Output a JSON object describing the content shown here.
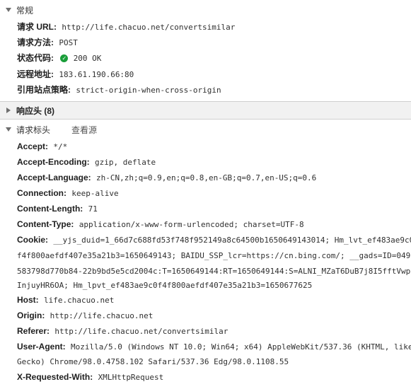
{
  "general": {
    "title": "常规",
    "request_url_label": "请求 URL:",
    "request_url": "http://life.chacuo.net/convertsimilar",
    "method_label": "请求方法:",
    "method": "POST",
    "status_label": "状态代码:",
    "status": "200 OK",
    "remote_label": "远程地址:",
    "remote": "183.61.190.66:80",
    "referrer_policy_label": "引用站点策略:",
    "referrer_policy": "strict-origin-when-cross-origin"
  },
  "response_headers": {
    "title": "响应头 (8)"
  },
  "request_headers": {
    "title": "请求标头",
    "view_source": "查看源",
    "accept": {
      "key": "Accept:",
      "value": "*/*"
    },
    "accept_encoding": {
      "key": "Accept-Encoding:",
      "value": "gzip, deflate"
    },
    "accept_language": {
      "key": "Accept-Language:",
      "value": "zh-CN,zh;q=0.9,en;q=0.8,en-GB;q=0.7,en-US;q=0.6"
    },
    "connection": {
      "key": "Connection:",
      "value": "keep-alive"
    },
    "content_length": {
      "key": "Content-Length:",
      "value": "71"
    },
    "content_type": {
      "key": "Content-Type:",
      "value": "application/x-www-form-urlencoded; charset=UTF-8"
    },
    "cookie": {
      "key": "Cookie:",
      "line1": "__yjs_duid=1_66d7c688fd53f748f952149a8c64500b1650649143014; Hm_lvt_ef483ae9c0",
      "line2": "f4f800aefdf407e35a21b3=1650649143; BAIDU_SSP_lcr=https://cn.bing.com/; __gads=ID=049",
      "line3": "583798d770b84-22b9bd5e5cd2004c:T=1650649144:RT=1650649144:S=ALNI_MZaT6DuB7j8I5fftVwp",
      "line4": "InjuyHR6OA; Hm_lpvt_ef483ae9c0f4f800aefdf407e35a21b3=1650677625"
    },
    "host": {
      "key": "Host:",
      "value": "life.chacuo.net"
    },
    "origin": {
      "key": "Origin:",
      "value": "http://life.chacuo.net"
    },
    "referer": {
      "key": "Referer:",
      "value": "http://life.chacuo.net/convertsimilar"
    },
    "user_agent": {
      "key": "User-Agent:",
      "line1": "Mozilla/5.0 (Windows NT 10.0; Win64; x64) AppleWebKit/537.36 (KHTML, like",
      "line2": "Gecko) Chrome/98.0.4758.102 Safari/537.36 Edg/98.0.1108.55"
    },
    "x_requested_with": {
      "key": "X-Requested-With:",
      "value": "XMLHttpRequest"
    }
  },
  "icons": {
    "expanded": "triangle-down-icon",
    "collapsed": "triangle-right-icon",
    "status_ok": "green-check-circle-icon"
  },
  "colors": {
    "status_ok": "#1a9e3a",
    "section_bar": "#f1f1f1"
  }
}
